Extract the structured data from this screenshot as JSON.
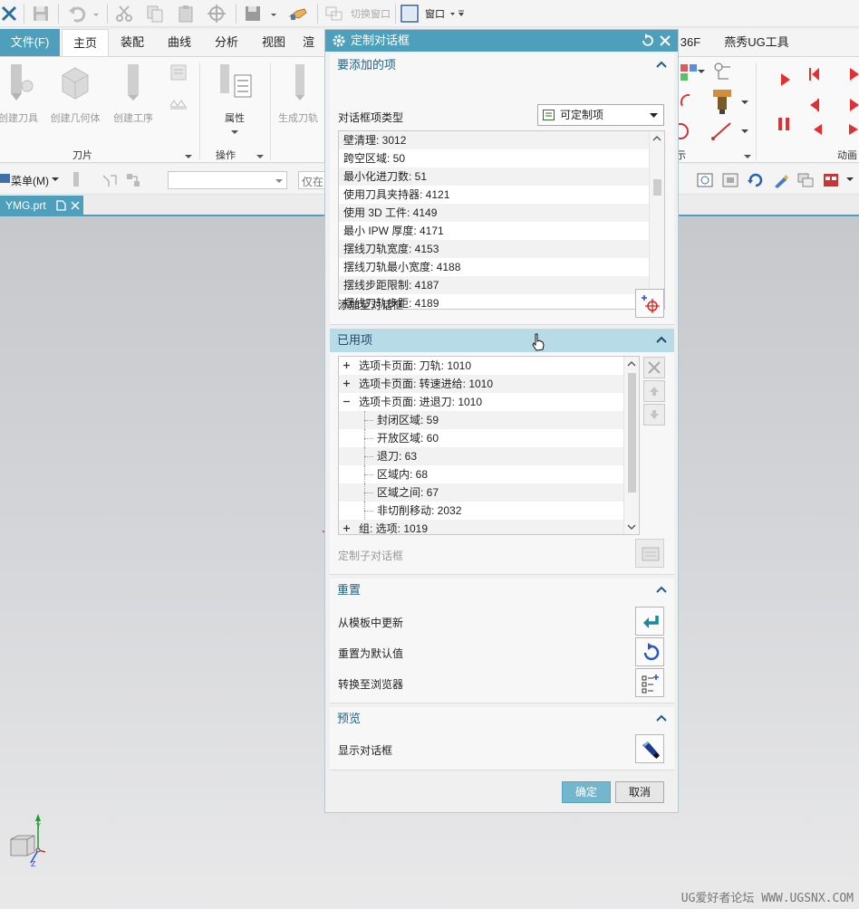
{
  "quick_access": {
    "switch_window": "切换窗口",
    "window": "窗口"
  },
  "menu": {
    "file": "文件(F)",
    "tabs": [
      "主页",
      "装配",
      "曲线",
      "分析",
      "视图",
      "渲染"
    ],
    "right_tabs": [
      "36F",
      "燕秀UG工具"
    ]
  },
  "ribbon": {
    "buttons": [
      "创建刀具",
      "创建几何体",
      "创建工序"
    ],
    "generate": "生成刀轨",
    "properties": "属性",
    "groups": [
      "刀片",
      "操作"
    ],
    "display_group": "示",
    "animation_group": "动画"
  },
  "toolbar": {
    "menu": "菜单(M)",
    "filter_hint": "仅在"
  },
  "document": {
    "tab": "YMG.prt"
  },
  "dialog": {
    "title": "定制对话框",
    "add_section": {
      "title": "要添加的项",
      "type_label": "对话框项类型",
      "type_value": "可定制项",
      "items": [
        "壁清理: 3012",
        "跨空区域: 50",
        "最小化进刀数: 51",
        "使用刀具夹持器: 4121",
        "使用 3D 工件: 4149",
        "最小 IPW 厚度: 4171",
        "摆线刀轨宽度: 4153",
        "摆线刀轨最小宽度: 4188",
        "摆线步距限制: 4187",
        "摆线刀轨步距: 4189"
      ],
      "add_label": "添加至对话框"
    },
    "used_section": {
      "title": "已用项",
      "tree": [
        {
          "label": "选项卡页面: 刀轨: 1010",
          "level": 0,
          "expander": "+"
        },
        {
          "label": "选项卡页面: 转速进给: 1010",
          "level": 0,
          "expander": "+"
        },
        {
          "label": "选项卡页面: 进退刀: 1010",
          "level": 0,
          "expander": "-"
        },
        {
          "label": "封闭区域: 59",
          "level": 1,
          "expander": ""
        },
        {
          "label": "开放区域: 60",
          "level": 1,
          "expander": ""
        },
        {
          "label": "退刀: 63",
          "level": 1,
          "expander": ""
        },
        {
          "label": "区域内: 68",
          "level": 1,
          "expander": ""
        },
        {
          "label": "区域之间: 67",
          "level": 1,
          "expander": ""
        },
        {
          "label": "非切削移动: 2032",
          "level": 1,
          "expander": ""
        },
        {
          "label": "组: 选项: 1019",
          "level": 0,
          "expander": "+"
        }
      ],
      "subdialog_label": "定制子对话框"
    },
    "reset_section": {
      "title": "重置",
      "update_from_template": "从模板中更新",
      "reset_default": "重置为默认值",
      "convert_browser": "转换至浏览器"
    },
    "preview_section": {
      "title": "预览",
      "show_dialog": "显示对话框"
    },
    "ok": "确定",
    "cancel": "取消"
  },
  "watermark": "UG爱好者论坛 WWW.UGSNX.COM",
  "colors": {
    "accent": "#4e9fbc",
    "section_highlight": "#b7dbe7",
    "section_title": "#1f5f80"
  }
}
